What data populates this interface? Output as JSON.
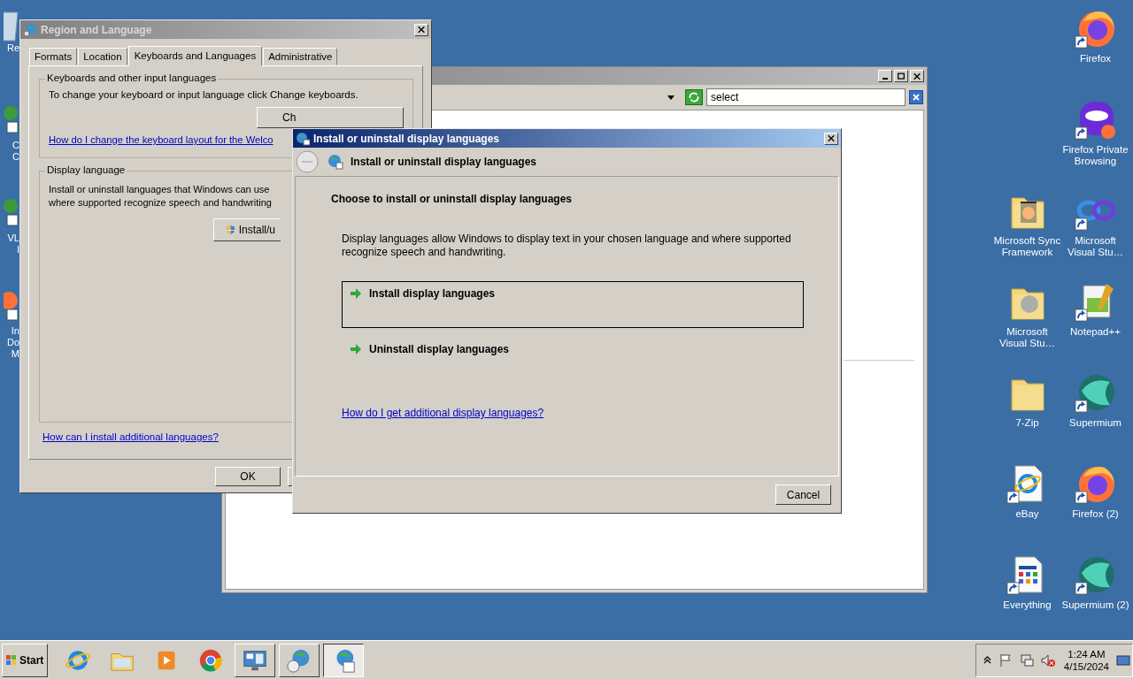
{
  "desktop": {
    "left_icons": [
      {
        "kind": "recycle-bin",
        "label_lines": [
          "Re"
        ]
      },
      {
        "kind": "app",
        "label_lines": [
          "C",
          "C"
        ]
      },
      {
        "kind": "app",
        "label_lines": [
          "VL",
          "I"
        ]
      },
      {
        "kind": "firefox",
        "label_lines": [
          "In",
          "Do",
          "M"
        ]
      }
    ],
    "right_icons": [
      {
        "icons": [
          {
            "kind": "firefox",
            "label": "Firefox",
            "shortcut": true
          }
        ]
      },
      {
        "icons": [
          {
            "kind": "private",
            "label": "Firefox Private Browsing",
            "shortcut": true
          }
        ]
      },
      {
        "icons": [
          {
            "kind": "folder-firefox",
            "label": "Microsoft Sync Framework",
            "shortcut": false
          },
          {
            "kind": "visual-studio",
            "label": "Microsoft Visual Stu…",
            "shortcut": true
          }
        ]
      },
      {
        "icons": [
          {
            "kind": "folder-help",
            "label": "Microsoft Visual Stu…",
            "shortcut": false
          },
          {
            "kind": "notepad",
            "label": "Notepad++",
            "shortcut": true
          }
        ]
      },
      {
        "icons": [
          {
            "kind": "folder",
            "label": "7-Zip",
            "shortcut": false
          },
          {
            "kind": "supermium",
            "label": "Supermium",
            "shortcut": true
          }
        ]
      },
      {
        "icons": [
          {
            "kind": "ie-doc",
            "label": "eBay",
            "shortcut": true
          },
          {
            "kind": "firefox",
            "label": "Firefox (2)",
            "shortcut": true
          }
        ]
      },
      {
        "icons": [
          {
            "kind": "everything",
            "label": "Everything",
            "shortcut": true
          },
          {
            "kind": "supermium",
            "label": "Supermium (2)",
            "shortcut": true
          }
        ]
      }
    ]
  },
  "background_window": {
    "search": {
      "value": "select"
    }
  },
  "region_dialog": {
    "title": "Region and Language",
    "active": false,
    "tabs": [
      {
        "label": "Formats",
        "selected": false
      },
      {
        "label": "Location",
        "selected": false
      },
      {
        "label": "Keyboards and Languages",
        "selected": true
      },
      {
        "label": "Administrative",
        "selected": false
      }
    ],
    "keyboards_group": {
      "legend": "Keyboards and other input languages",
      "text": "To change your keyboard or input language click Change keyboards.",
      "button": "Ch",
      "link": "How do I change the keyboard layout for the Welco"
    },
    "display_group": {
      "legend": "Display language",
      "lines": [
        "Install or uninstall languages that Windows can use",
        "where supported recognize speech and handwriting"
      ],
      "button": "Install/u"
    },
    "link": "How can I install additional languages?",
    "buttons": [
      "OK"
    ]
  },
  "install_dialog": {
    "title": "Install or uninstall display languages",
    "active": true,
    "nav_title": "Install or uninstall display languages",
    "heading": "Choose to install or uninstall display languages",
    "description": "Display languages allow Windows to display text in your chosen language and where supported recognize speech and handwriting.",
    "options": [
      {
        "label": "Install display languages",
        "selected": true
      },
      {
        "label": "Uninstall display languages",
        "selected": false
      }
    ],
    "link": "How do I get additional display languages?",
    "buttons": [
      "Cancel"
    ]
  },
  "taskbar": {
    "start": "Start",
    "items": [
      {
        "kind": "ie",
        "running": false,
        "selected": false
      },
      {
        "kind": "explorer",
        "running": false,
        "selected": false
      },
      {
        "kind": "media",
        "running": false,
        "selected": false
      },
      {
        "kind": "chrome",
        "running": false,
        "selected": false
      },
      {
        "kind": "control-panel",
        "running": true,
        "selected": false
      },
      {
        "kind": "globe-clock",
        "running": true,
        "selected": false
      },
      {
        "kind": "globe-check",
        "running": true,
        "selected": true
      }
    ],
    "time": "1:24 AM",
    "date": "4/15/2024"
  }
}
